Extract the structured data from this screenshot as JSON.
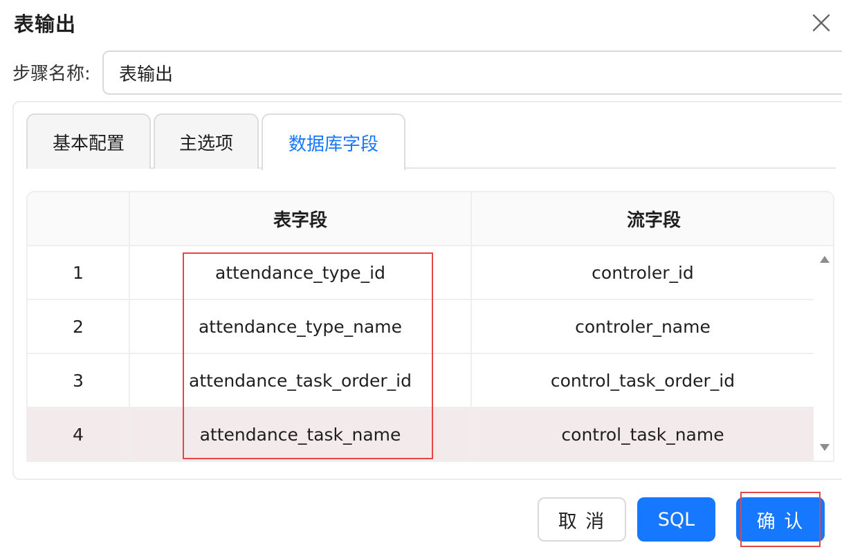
{
  "dialog": {
    "title": "表输出",
    "close_icon": "close-icon"
  },
  "step": {
    "label": "步骤名称:",
    "value": "表输出"
  },
  "tabs": [
    {
      "label": "基本配置",
      "active": false
    },
    {
      "label": "主选项",
      "active": false
    },
    {
      "label": "数据库字段",
      "active": true
    }
  ],
  "table": {
    "headers": [
      "",
      "表字段",
      "流字段"
    ],
    "rows": [
      {
        "index": "1",
        "table_field": "attendance_type_id",
        "stream_field": "controler_id"
      },
      {
        "index": "2",
        "table_field": "attendance_type_name",
        "stream_field": "controler_name"
      },
      {
        "index": "3",
        "table_field": "attendance_task_order_id",
        "stream_field": "control_task_order_id"
      },
      {
        "index": "4",
        "table_field": "attendance_task_name",
        "stream_field": "control_task_name"
      }
    ]
  },
  "footer": {
    "cancel_label": "取 消",
    "sql_label": "SQL",
    "ok_label": "确 认"
  },
  "colors": {
    "primary": "#1677ff",
    "highlight": "#e54545",
    "row_hover": "#f3ebeb"
  }
}
